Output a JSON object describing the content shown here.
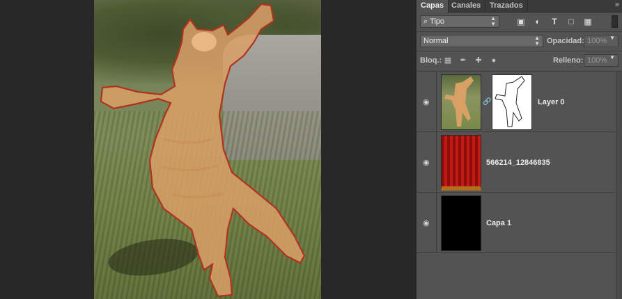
{
  "panel": {
    "tabs": [
      "Capas",
      "Canales",
      "Trazados"
    ],
    "menu_icon": "panel-menu-icon",
    "filter": {
      "kind_label": "Tipo",
      "icons": [
        "image-filter-icon",
        "adjustment-filter-icon",
        "type-filter-icon",
        "shape-filter-icon",
        "smart-object-filter-icon"
      ]
    },
    "blend_mode": "Normal",
    "opacity": {
      "label": "Opacidad:",
      "value": "100%"
    },
    "lock": {
      "label": "Bloq.:",
      "icons": [
        "lock-transparent-icon",
        "lock-image-icon",
        "lock-position-icon",
        "lock-all-icon"
      ]
    },
    "fill": {
      "label": "Relleno:",
      "value": "100%"
    },
    "layers": [
      {
        "name": "Layer 0",
        "visible": true,
        "has_mask": true,
        "thumbnail": "cat-photo"
      },
      {
        "name": "566214_12846835",
        "visible": true,
        "has_mask": false,
        "thumbnail": "red-curtain"
      },
      {
        "name": "Capa 1",
        "visible": true,
        "has_mask": false,
        "thumbnail": "black-fill"
      }
    ]
  },
  "colors": {
    "canvas_bg": "#282828",
    "panel_bg": "#535353",
    "selection_outline": "#b0321f"
  }
}
